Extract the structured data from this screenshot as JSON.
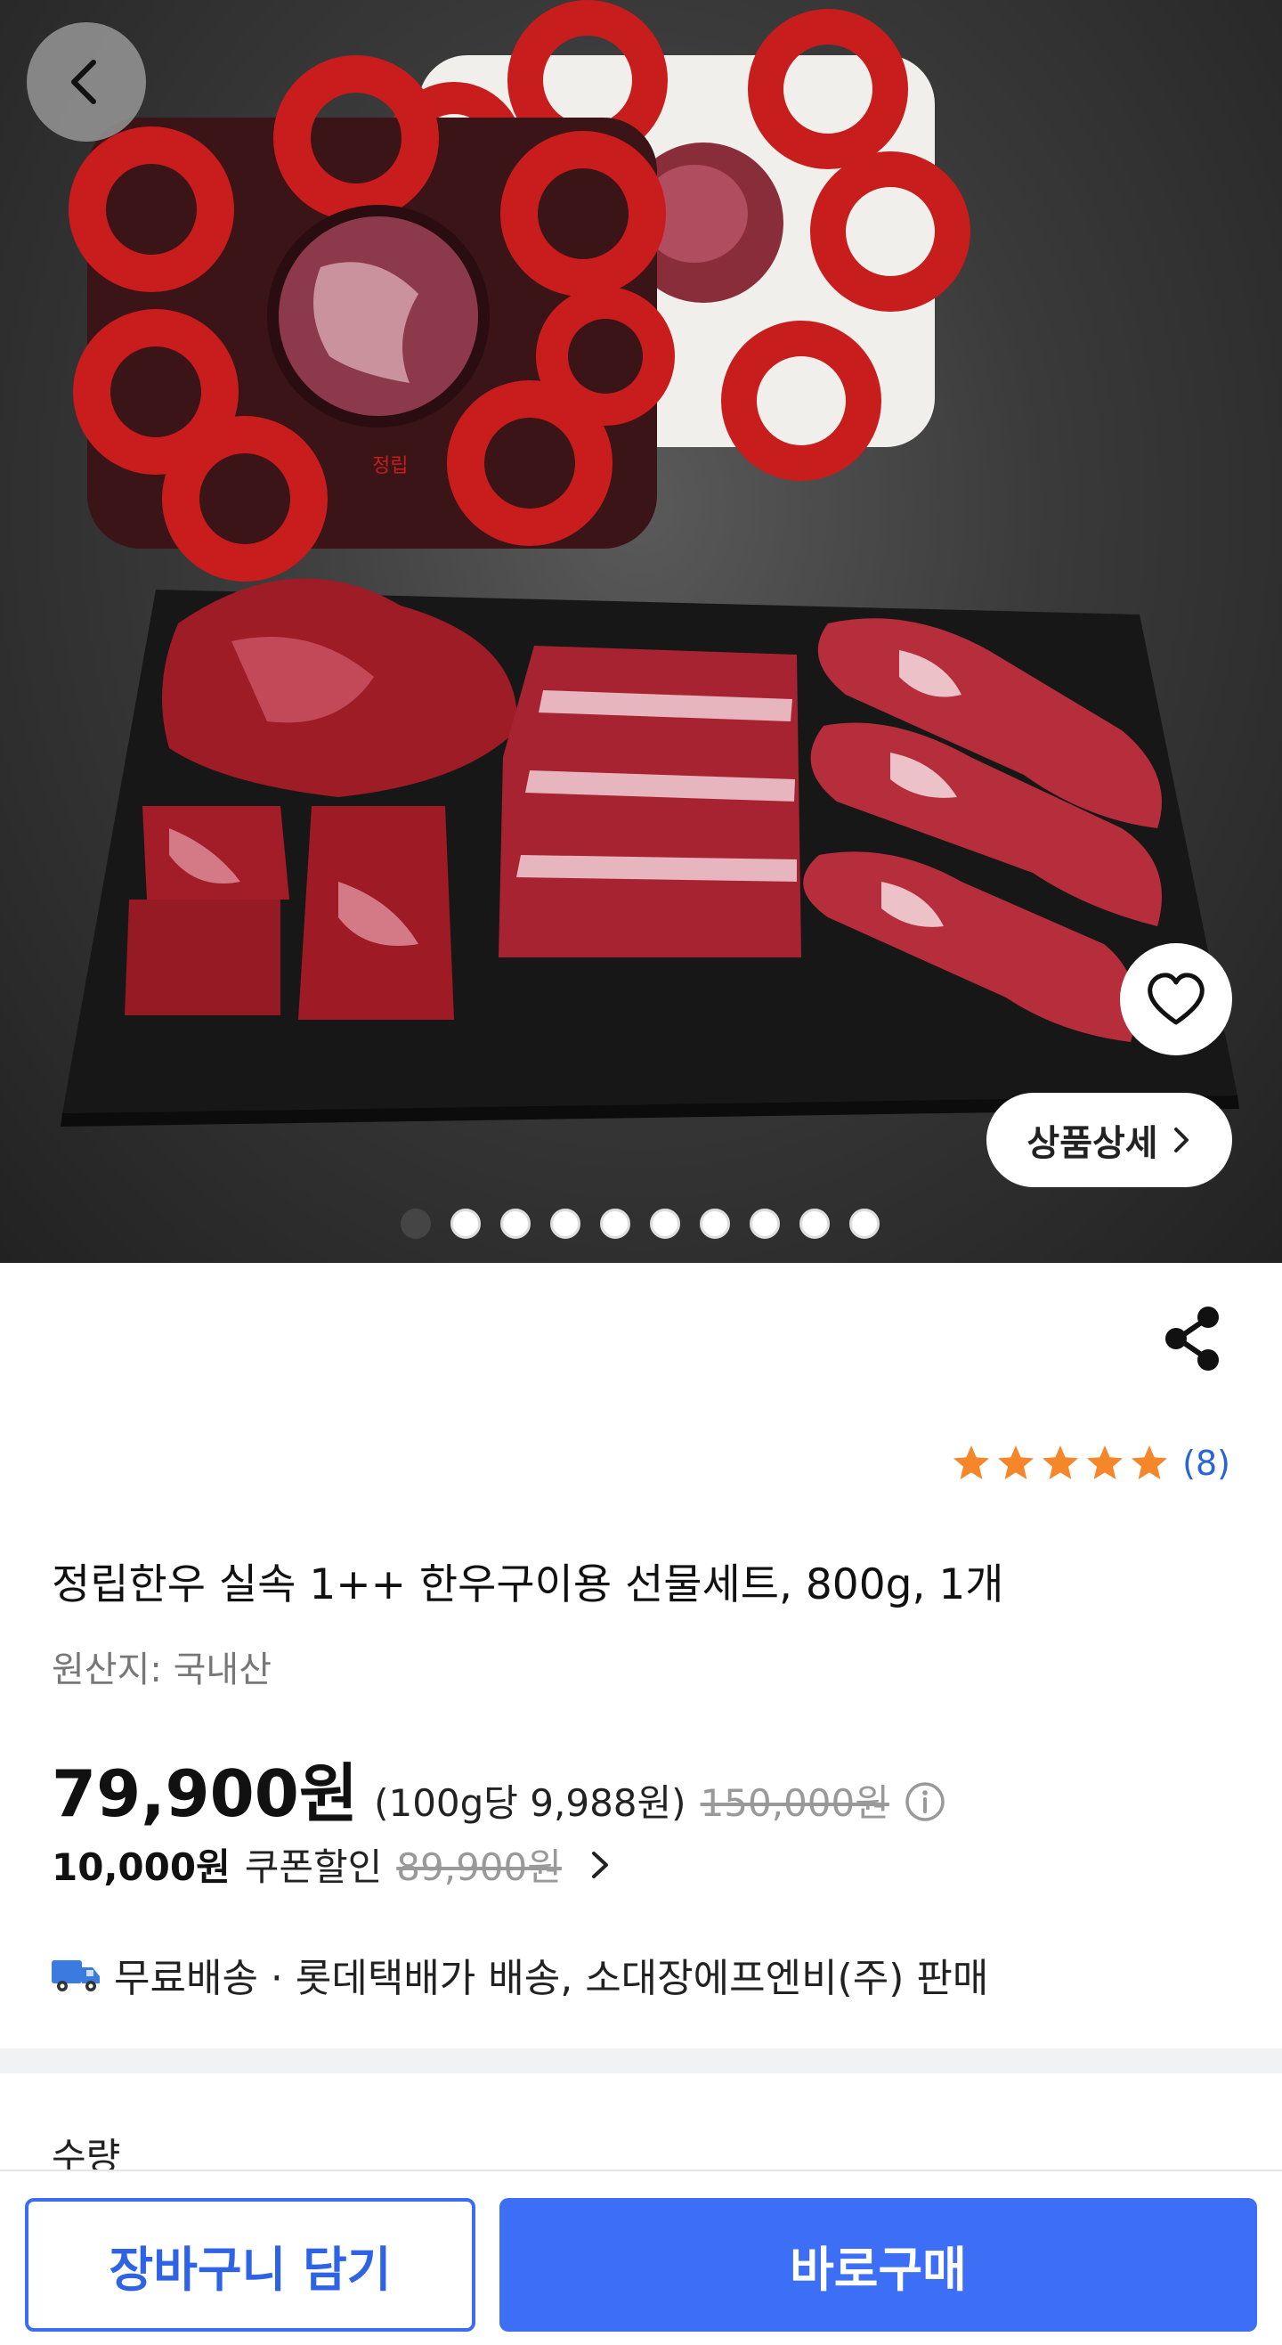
{
  "hero": {
    "image_alt": "정립",
    "detail_button_label": "상품상세",
    "slide_count": 10,
    "active_slide": 1
  },
  "product": {
    "rating_stars": 5,
    "review_count": "(8)",
    "title": "정립한우 실속 1++ 한우구이용 선물세트, 800g, 1개",
    "origin": "원산지: 국내산",
    "price": "79,900원",
    "unit_price": "(100g당 9,988원)",
    "original_price": "150,000원"
  },
  "coupon": {
    "amount": "10,000원",
    "label": "쿠폰할인",
    "price": "89,900원"
  },
  "shipping": {
    "text": "무료배송 · 롯데택배가 배송, 소대장에프엔비(주) 판매"
  },
  "quantity": {
    "label": "수량"
  },
  "actions": {
    "cart_label": "장바구니 담기",
    "buy_label": "바로구매"
  },
  "colors": {
    "accent": "#3c6ff5",
    "star": "#f5862a",
    "review_link": "#2a63d6"
  }
}
